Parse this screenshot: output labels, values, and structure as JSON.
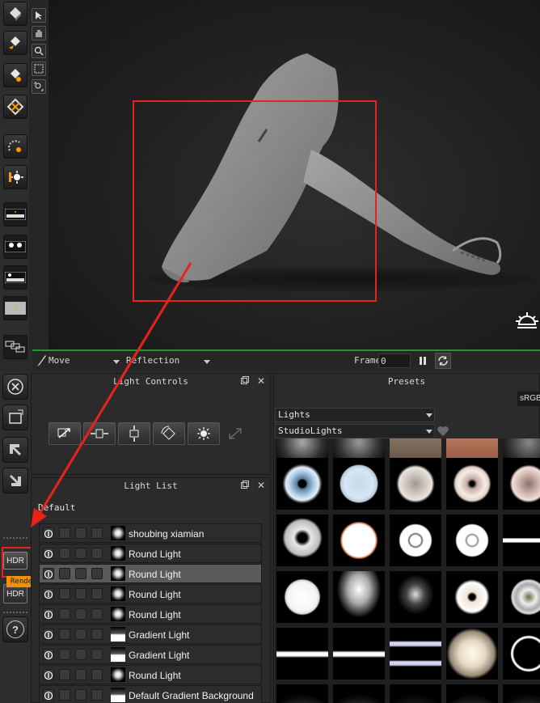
{
  "statusbar": {
    "tool": "Move",
    "mode": "Reflection",
    "frame_label": "Frame",
    "frame_value": "0"
  },
  "light_controls": {
    "title": "Light Controls"
  },
  "light_list": {
    "title": "Light List",
    "group": "Default",
    "items": [
      {
        "name": "shoubing xiamian",
        "thumb": "round",
        "selected": false
      },
      {
        "name": "Round Light",
        "thumb": "round",
        "selected": false
      },
      {
        "name": "Round Light",
        "thumb": "round",
        "selected": true
      },
      {
        "name": "Round Light",
        "thumb": "round",
        "selected": false
      },
      {
        "name": "Round Light",
        "thumb": "round",
        "selected": false
      },
      {
        "name": "Gradient Light",
        "thumb": "gradient",
        "selected": false
      },
      {
        "name": "Gradient Light",
        "thumb": "gradient",
        "selected": false
      },
      {
        "name": "Round Light",
        "thumb": "round",
        "selected": false
      },
      {
        "name": "Default Gradient Background",
        "thumb": "gradient",
        "selected": false
      }
    ]
  },
  "presets": {
    "title": "Presets",
    "colorspace": "sRGB",
    "category": "Lights",
    "library": "StudioLights"
  },
  "sidebar": {
    "hdr_label": "HDR",
    "hdr2_label": "HDR",
    "help_label": "?"
  },
  "tooltip": {
    "text": "Render Production HDRI"
  },
  "colors": {
    "annotation_red": "#e8231b",
    "accent_green": "#1f9a2f",
    "tooltip_orange": "#f39200"
  }
}
